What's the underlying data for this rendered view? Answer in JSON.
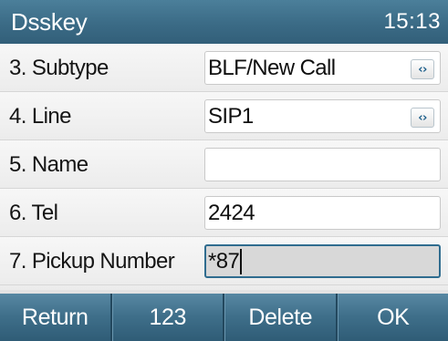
{
  "header": {
    "title": "Dsskey",
    "time": "15:13"
  },
  "rows": [
    {
      "label": "3.  Subtype",
      "value": "BLF/New Call",
      "has_selector": true,
      "selector_icon": "left-right-arrows-icon"
    },
    {
      "label": "4.  Line",
      "value": "SIP1",
      "has_selector": true,
      "selector_icon": "left-right-arrows-icon"
    },
    {
      "label": "5.  Name",
      "value": "",
      "has_selector": false
    },
    {
      "label": "6.  Tel",
      "value": "2424",
      "has_selector": false
    },
    {
      "label": "7.  Pickup Number",
      "value": "*87",
      "has_selector": false,
      "active": true
    }
  ],
  "selector_glyph": "‹›",
  "softkeys": {
    "return": "Return",
    "input_mode": "123",
    "delete": "Delete",
    "ok": "OK"
  },
  "colors": {
    "accent": "#3b6b86",
    "active_border": "#2f6c8f"
  }
}
